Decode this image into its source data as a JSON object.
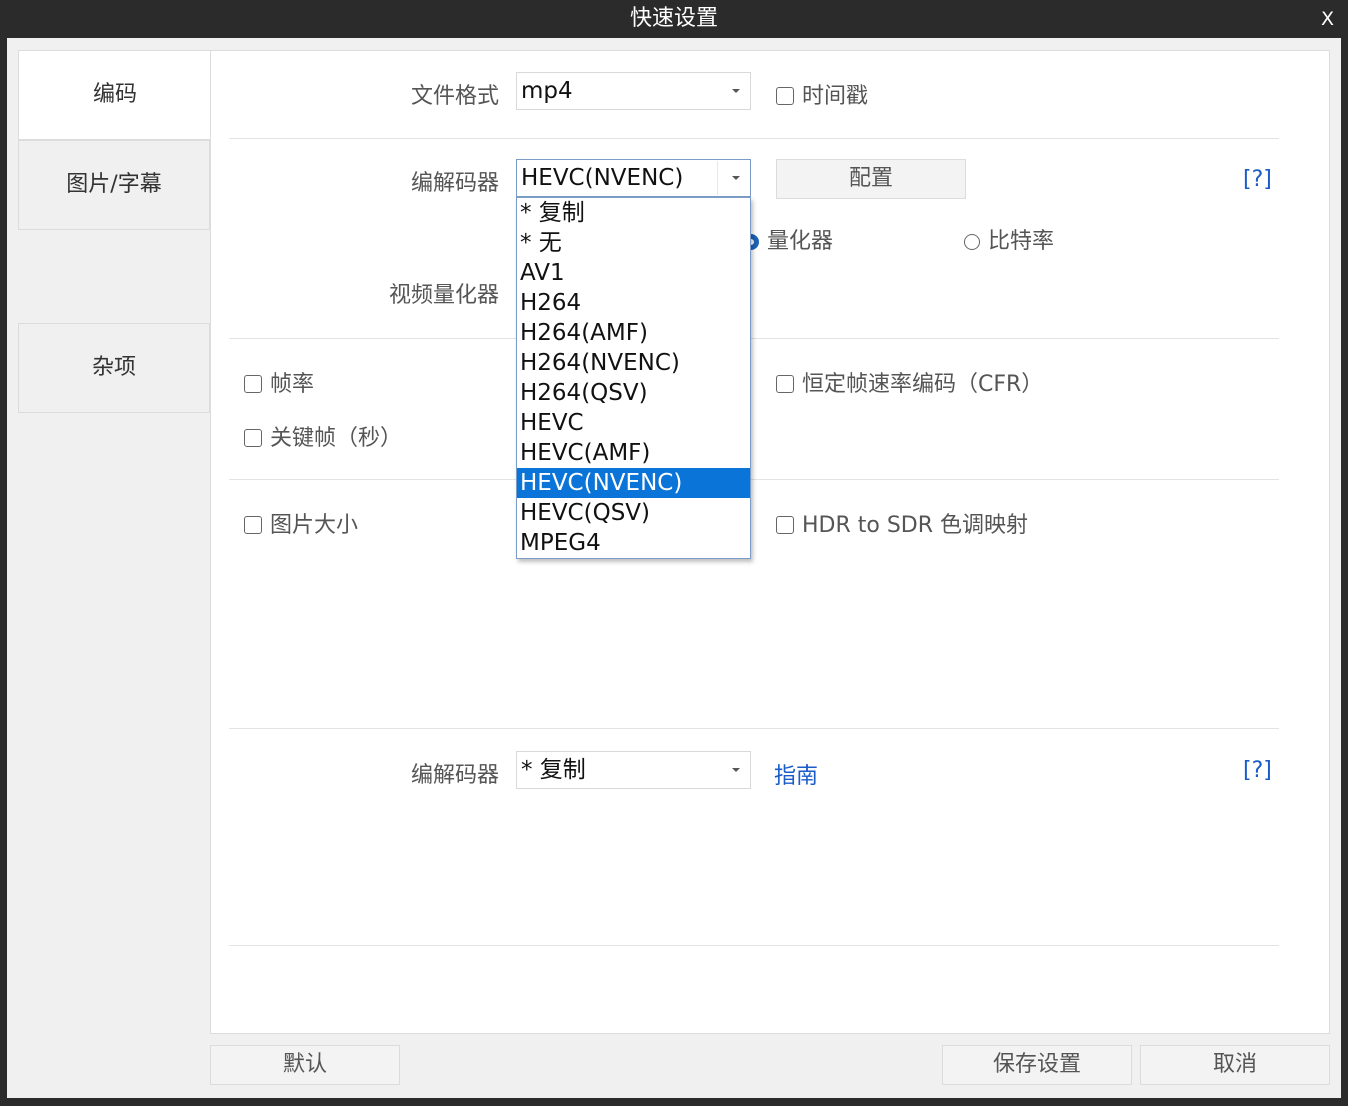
{
  "window": {
    "title": "快速设置",
    "close_label": "X"
  },
  "sidebar": {
    "items": [
      {
        "label": "编码"
      },
      {
        "label": "图片/字幕"
      },
      {
        "label": "杂项"
      }
    ]
  },
  "format": {
    "label": "文件格式",
    "value": "mp4",
    "timestamp_label": "时间戳"
  },
  "video": {
    "codec_label": "编解码器",
    "codec_value": "HEVC(NVENC)",
    "config_button": "配置",
    "help_link": "[?]",
    "quantizer_radio": "量化器",
    "bitrate_radio": "比特率",
    "quantizer_label": "视频量化器",
    "codec_options": [
      "* 复制",
      "* 无",
      "AV1",
      "H264",
      "H264(AMF)",
      "H264(NVENC)",
      "H264(QSV)",
      "HEVC",
      "HEVC(AMF)",
      "HEVC(NVENC)",
      "HEVC(QSV)",
      "MPEG4"
    ],
    "selected_index": 9
  },
  "framerate": {
    "fps_label": "帧率",
    "keyframe_label": "关键帧（秒）",
    "cfr_label": "恒定帧速率编码（CFR）"
  },
  "image": {
    "size_label": "图片大小",
    "hdr_label": "HDR to SDR 色调映射"
  },
  "audio": {
    "codec_label": "编解码器",
    "codec_value": "* 复制",
    "guide_link": "指南",
    "help_link": "[?]"
  },
  "footer": {
    "default_button": "默认",
    "save_button": "保存设置",
    "cancel_button": "取消"
  },
  "colors": {
    "accent": "#0a74d8",
    "link": "#1a5cc8",
    "titlebar": "#2b2b2b"
  }
}
